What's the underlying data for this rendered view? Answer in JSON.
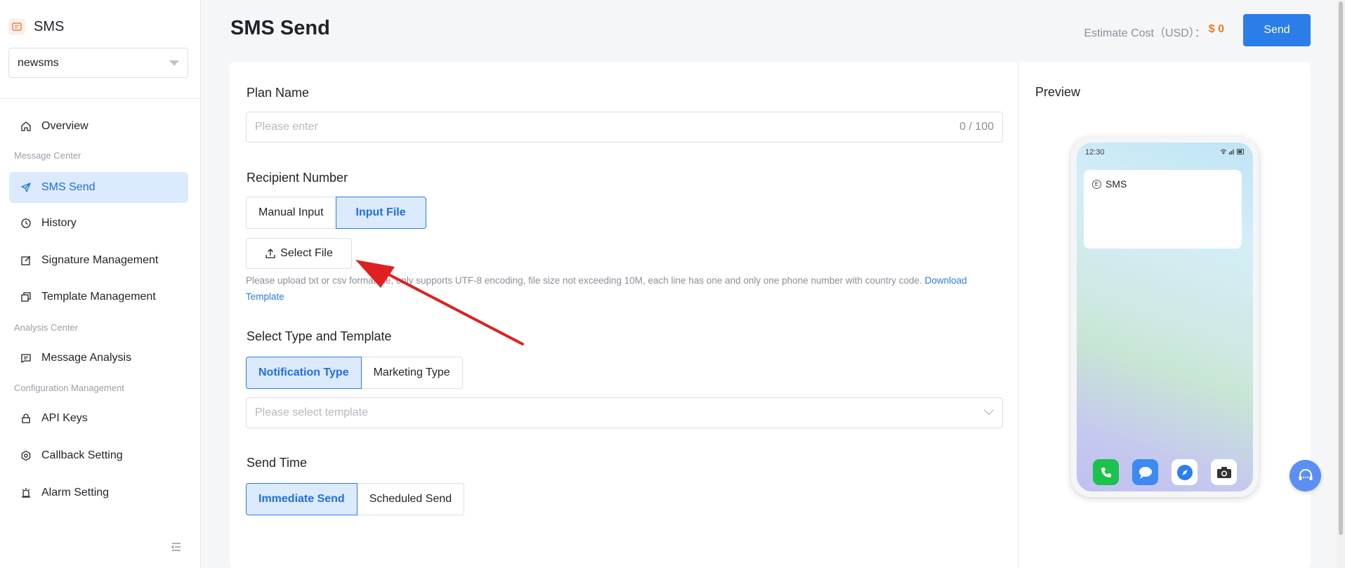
{
  "sidebar": {
    "brand": "SMS",
    "app_select": "newsms",
    "items": [
      {
        "label": "Overview"
      },
      {
        "label": "SMS Send"
      },
      {
        "label": "History"
      },
      {
        "label": "Signature Management"
      },
      {
        "label": "Template Management"
      },
      {
        "label": "Message Analysis"
      },
      {
        "label": "API Keys"
      },
      {
        "label": "Callback Setting"
      },
      {
        "label": "Alarm Setting"
      }
    ],
    "groups": [
      "Message Center",
      "Analysis Center",
      "Configuration Management"
    ]
  },
  "header": {
    "title": "SMS Send",
    "cost_label": "Estimate Cost（USD）：",
    "cost_value": "$ 0",
    "send_label": "Send"
  },
  "form": {
    "plan_name_label": "Plan Name",
    "plan_name_placeholder": "Please enter",
    "plan_name_counter": "0 / 100",
    "recipient_label": "Recipient Number",
    "recipient_tabs": [
      "Manual Input",
      "Input File"
    ],
    "select_file_label": "Select File",
    "hint_text": "Please upload txt or csv format file, only supports UTF-8 encoding, file size not exceeding 10M, each line has one and only one phone number with country code.",
    "hint_link": "Download Template",
    "type_label": "Select Type and Template",
    "type_tabs": [
      "Notification Type",
      "Marketing Type"
    ],
    "template_placeholder": "Please select template",
    "send_time_label": "Send Time",
    "send_time_tabs": [
      "Immediate Send",
      "Scheduled Send"
    ]
  },
  "preview": {
    "title": "Preview",
    "time": "12:30",
    "sms_badge": "E",
    "sms_sender": "SMS"
  },
  "colors": {
    "accent": "#2b7de9",
    "cost": "#e67e22",
    "annotation_arrow": "#e02020"
  }
}
